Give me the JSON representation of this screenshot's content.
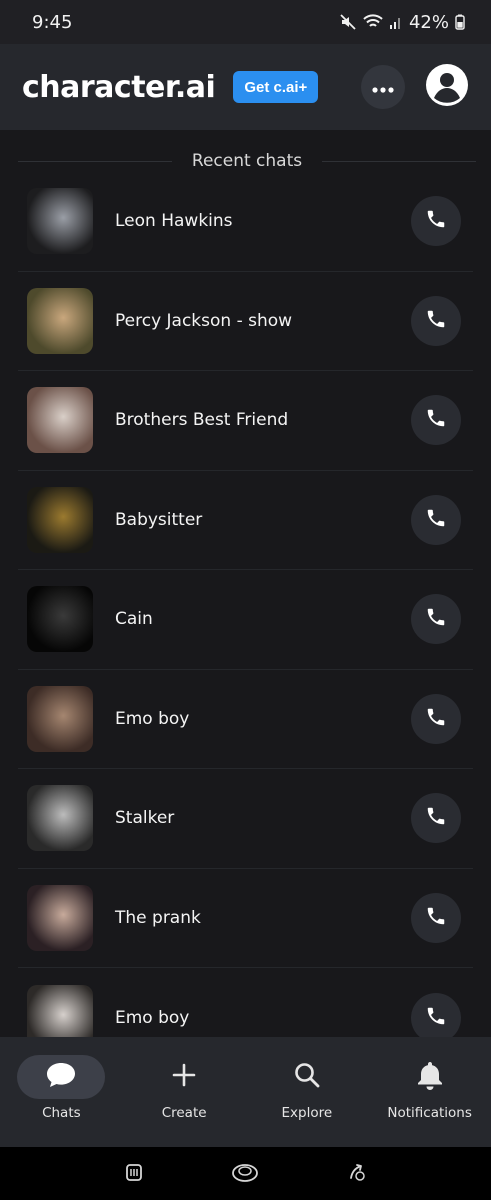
{
  "status_bar": {
    "time": "9:45",
    "battery": "42%",
    "icons": [
      "mute-icon",
      "wifi-icon",
      "signal-icon",
      "battery-icon"
    ]
  },
  "header": {
    "brand": "character.ai",
    "cta_label": "Get c.ai+",
    "icons": [
      "more-icon",
      "profile-icon"
    ]
  },
  "section": {
    "title": "Recent chats"
  },
  "chats": [
    {
      "name": "Leon Hawkins",
      "thumb_colors": [
        "#1d1d1f",
        "#9a9ea6"
      ]
    },
    {
      "name": "Percy Jackson - show",
      "thumb_colors": [
        "#4e4a2c",
        "#c9a77d"
      ]
    },
    {
      "name": "Brothers Best Friend",
      "thumb_colors": [
        "#6b5148",
        "#d9cfc8"
      ]
    },
    {
      "name": "Babysitter",
      "thumb_colors": [
        "#1b1a14",
        "#9b7a2f"
      ]
    },
    {
      "name": "Cain",
      "thumb_colors": [
        "#060606",
        "#3a3a3a"
      ]
    },
    {
      "name": "Emo boy",
      "thumb_colors": [
        "#3d2c26",
        "#a58670"
      ]
    },
    {
      "name": "Stalker",
      "thumb_colors": [
        "#2a2a2a",
        "#bcbcbc"
      ]
    },
    {
      "name": "The prank",
      "thumb_colors": [
        "#2b2024",
        "#c7aa9b"
      ]
    },
    {
      "name": "Emo boy",
      "thumb_colors": [
        "#2d2a28",
        "#d6d0cc"
      ]
    }
  ],
  "bottom_nav": [
    {
      "label": "Chats",
      "icon": "chat-bubble-icon",
      "active": true
    },
    {
      "label": "Create",
      "icon": "plus-icon",
      "active": false
    },
    {
      "label": "Explore",
      "icon": "search-icon",
      "active": false
    },
    {
      "label": "Notifications",
      "icon": "bell-icon",
      "active": false
    }
  ],
  "system_nav": [
    "recents-icon",
    "home-icon",
    "back-icon"
  ],
  "colors": {
    "background": "#18181b",
    "header": "#26282d",
    "accent": "#2b8ff0",
    "call_button": "#2a2c32"
  }
}
